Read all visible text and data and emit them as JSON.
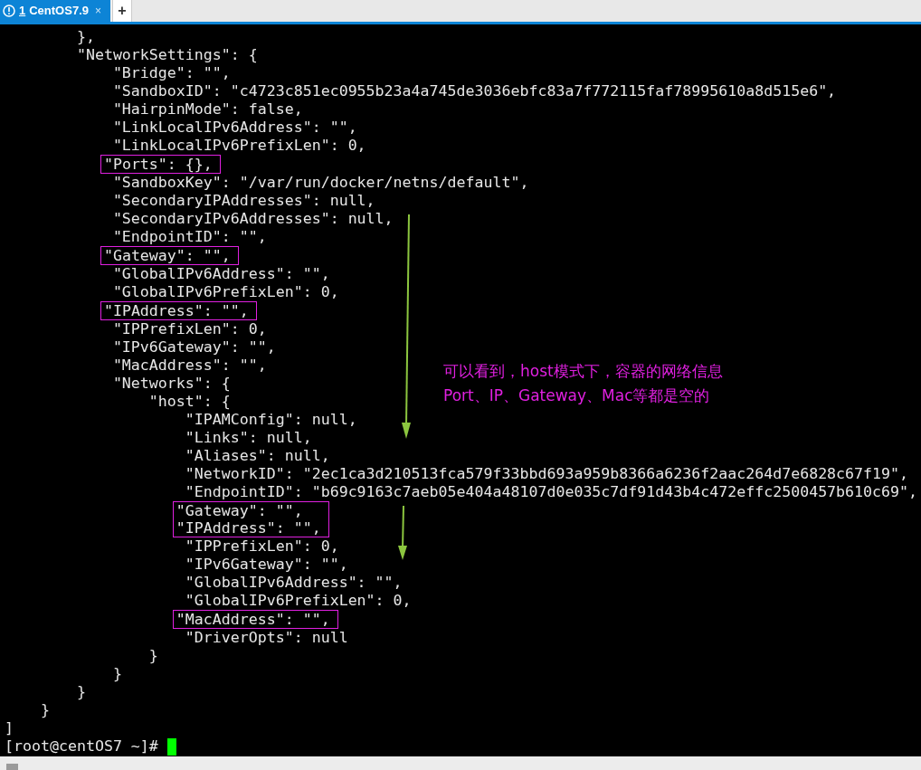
{
  "tabs": [
    {
      "number": "1",
      "label": "CentOS7.9",
      "close": "×",
      "selected": true,
      "warning": true
    }
  ],
  "new_tab": "+",
  "terminal": {
    "lines": [
      {
        "text": "        },",
        "boxed": false
      },
      {
        "text": "        \"NetworkSettings\": {",
        "boxed": false
      },
      {
        "text": "            \"Bridge\": \"\",",
        "boxed": false
      },
      {
        "text": "            \"SandboxID\": \"c4723c851ec0955b23a4a745de3036ebfc83a7f772115faf78995610a8d515e6\",",
        "boxed": false
      },
      {
        "text": "            \"HairpinMode\": false,",
        "boxed": false
      },
      {
        "text": "            \"LinkLocalIPv6Address\": \"\",",
        "boxed": false
      },
      {
        "text": "            \"LinkLocalIPv6PrefixLen\": 0,",
        "boxed": false
      },
      {
        "text": "            \"Ports\": {},",
        "boxed": true
      },
      {
        "text": "            \"SandboxKey\": \"/var/run/docker/netns/default\",",
        "boxed": false
      },
      {
        "text": "            \"SecondaryIPAddresses\": null,",
        "boxed": false
      },
      {
        "text": "            \"SecondaryIPv6Addresses\": null,",
        "boxed": false
      },
      {
        "text": "            \"EndpointID\": \"\",",
        "boxed": false
      },
      {
        "text": "            \"Gateway\": \"\",",
        "boxed": true
      },
      {
        "text": "            \"GlobalIPv6Address\": \"\",",
        "boxed": false
      },
      {
        "text": "            \"GlobalIPv6PrefixLen\": 0,",
        "boxed": false
      },
      {
        "text": "            \"IPAddress\": \"\",",
        "boxed": true
      },
      {
        "text": "            \"IPPrefixLen\": 0,",
        "boxed": false
      },
      {
        "text": "            \"IPv6Gateway\": \"\",",
        "boxed": false
      },
      {
        "text": "            \"MacAddress\": \"\",",
        "boxed": false
      },
      {
        "text": "            \"Networks\": {",
        "boxed": false
      },
      {
        "text": "                \"host\": {",
        "boxed": false
      },
      {
        "text": "                    \"IPAMConfig\": null,",
        "boxed": false
      },
      {
        "text": "                    \"Links\": null,",
        "boxed": false
      },
      {
        "text": "                    \"Aliases\": null,",
        "boxed": false
      },
      {
        "text": "                    \"NetworkID\": \"2ec1ca3d210513fca579f33bbd693a959b8366a6236f2aac264d7e6828c67f19\",",
        "boxed": false
      },
      {
        "text": "                    \"EndpointID\": \"b69c9163c7aeb05e404a48107d0e035c7df91d43b4c472effc2500457b610c69\",",
        "boxed": false
      },
      {
        "text": "                    \"Gateway\": \"\",",
        "boxed": true
      },
      {
        "text": "                    \"IPAddress\": \"\",",
        "boxed": true
      },
      {
        "text": "                    \"IPPrefixLen\": 0,",
        "boxed": false
      },
      {
        "text": "                    \"IPv6Gateway\": \"\",",
        "boxed": false
      },
      {
        "text": "                    \"GlobalIPv6Address\": \"\",",
        "boxed": false
      },
      {
        "text": "                    \"GlobalIPv6PrefixLen\": 0,",
        "boxed": false
      },
      {
        "text": "                    \"MacAddress\": \"\",",
        "boxed": true
      },
      {
        "text": "                    \"DriverOpts\": null",
        "boxed": false
      },
      {
        "text": "                }",
        "boxed": false
      },
      {
        "text": "            }",
        "boxed": false
      },
      {
        "text": "        }",
        "boxed": false
      },
      {
        "text": "    }",
        "boxed": false
      },
      {
        "text": "]",
        "boxed": false
      }
    ],
    "prompt": "[root@centOS7 ~]#",
    "cursor": true
  },
  "annotation": {
    "lines": [
      "可以看到，host模式下，容器的网络信息",
      "Port、IP、Gateway、Mac等都是空的"
    ]
  }
}
